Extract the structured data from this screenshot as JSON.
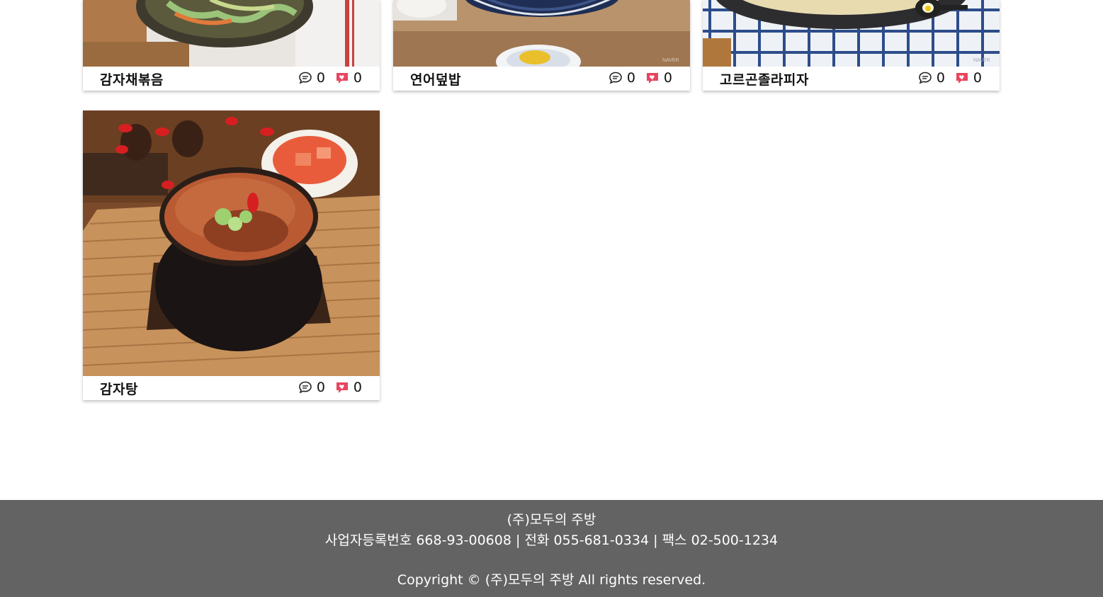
{
  "recipes": [
    {
      "title": "감자채볶음",
      "comments": "0",
      "likes": "0"
    },
    {
      "title": "연어덮밥",
      "comments": "0",
      "likes": "0"
    },
    {
      "title": "고르곤졸라피자",
      "comments": "0",
      "likes": "0"
    },
    {
      "title": "감자탕",
      "comments": "0",
      "likes": "0"
    }
  ],
  "icons": {
    "comment": "comment-icon",
    "like": "heart-chat-icon",
    "like_color": "#e8455f"
  },
  "footer": {
    "company": "(주)모두의 주방",
    "biz_label": "사업자등록번호",
    "biz_number": "668-93-00608",
    "phone_label": "전화",
    "phone_number": "055-681-0334",
    "fax_label": "팩스",
    "fax_number": "02-500-1234",
    "separator": "|",
    "copyright": "Copyright © (주)모두의 주방 All rights reserved."
  }
}
